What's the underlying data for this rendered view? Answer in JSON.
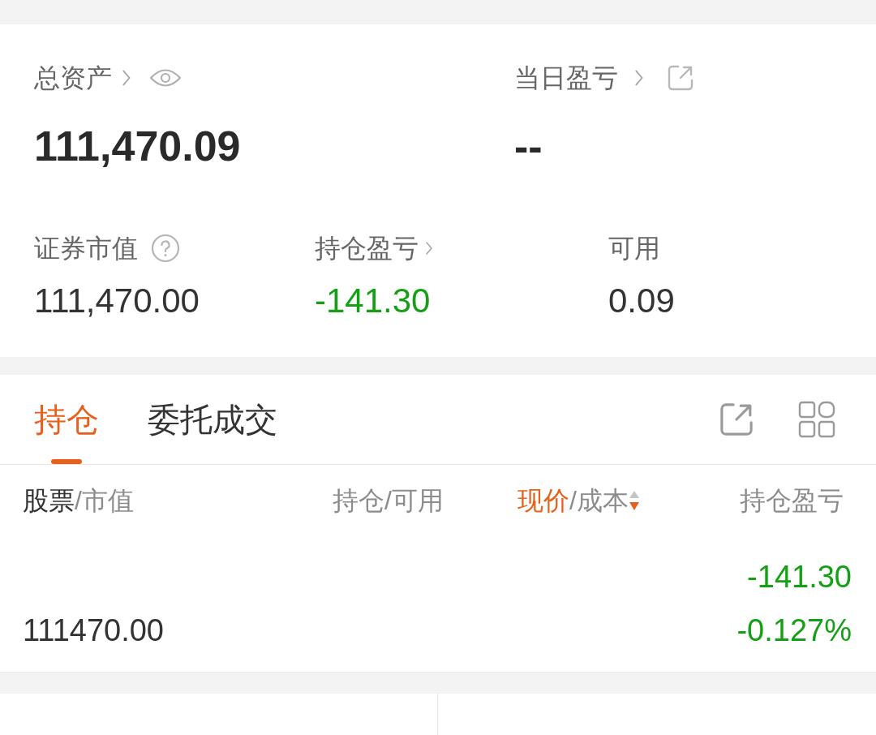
{
  "summary": {
    "total_assets": {
      "label": "总资产",
      "value": "111,470.09"
    },
    "daily_pnl": {
      "label": "当日盈亏",
      "value": "--"
    },
    "stats": [
      {
        "label": "证券市值",
        "kind": "help",
        "value": "111,470.00",
        "negative": false
      },
      {
        "label": "持仓盈亏",
        "kind": "link",
        "value": "-141.30",
        "negative": true
      },
      {
        "label": "可用",
        "kind": "plain",
        "value": "0.09",
        "negative": false
      }
    ]
  },
  "tabs": [
    {
      "label": "持仓",
      "selected": true
    },
    {
      "label": "委托成交",
      "selected": false
    }
  ],
  "table": {
    "columns": [
      {
        "parts": [
          {
            "text": "股票",
            "emphasized": true,
            "selected": false
          },
          {
            "text": "/市值",
            "emphasized": false,
            "selected": false
          }
        ]
      },
      {
        "parts": [
          {
            "text": "持仓/可用",
            "emphasized": false,
            "selected": false
          }
        ]
      },
      {
        "parts": [
          {
            "text": "现价",
            "emphasized": false,
            "selected": true
          },
          {
            "text": "/成本",
            "emphasized": false,
            "selected": false
          }
        ],
        "sorted": true,
        "sort_descending": true
      },
      {
        "parts": [
          {
            "text": "持仓盈亏",
            "emphasized": false,
            "selected": false
          }
        ]
      }
    ],
    "rows": [
      {
        "market_value": "111470.00",
        "pnl": "-141.30",
        "pnl_pct": "-0.127%",
        "negative": true
      }
    ]
  }
}
